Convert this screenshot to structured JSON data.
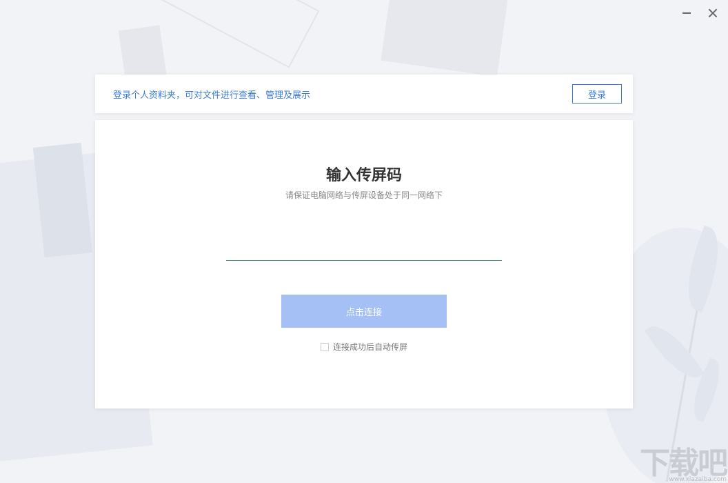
{
  "window": {
    "minimize_icon": "minimize-icon",
    "close_icon": "close-icon"
  },
  "login_bar": {
    "message": "登录个人资料夹，可对文件进行查看、管理及展示",
    "login_button": "登录"
  },
  "main": {
    "title": "输入传屏码",
    "subtitle": "请保证电脑网络与传屏设备处于同一网络下",
    "code_input_value": "",
    "connect_button": "点击连接",
    "auto_cast_label": "连接成功后自动传屏",
    "auto_cast_checked": false
  },
  "watermark": {
    "logo_text": "下载吧",
    "url": "www.xiazaiba.com"
  },
  "colors": {
    "accent": "#3b7bd6",
    "button_disabled": "#a4c0f4",
    "background": "#f2f3f6"
  }
}
